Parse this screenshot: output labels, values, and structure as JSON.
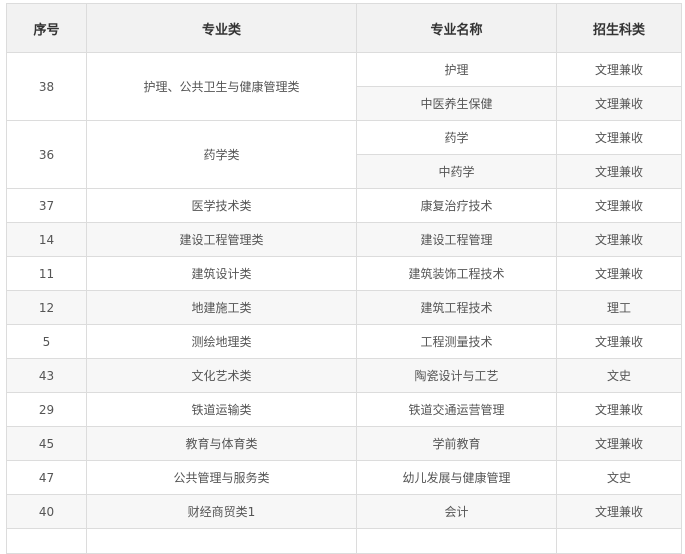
{
  "table": {
    "headers": [
      "序号",
      "专业类",
      "专业名称",
      "招生科类"
    ],
    "rows": [
      {
        "num": "38",
        "category": "护理、公共卫生与健康管理类",
        "majors": [
          {
            "name": "护理",
            "subject": "文理兼收"
          },
          {
            "name": "中医养生保健",
            "subject": "文理兼收"
          }
        ]
      },
      {
        "num": "36",
        "category": "药学类",
        "majors": [
          {
            "name": "药学",
            "subject": "文理兼收"
          },
          {
            "name": "中药学",
            "subject": "文理兼收"
          }
        ]
      },
      {
        "num": "37",
        "category": "医学技术类",
        "majors": [
          {
            "name": "康复治疗技术",
            "subject": "文理兼收"
          }
        ]
      },
      {
        "num": "14",
        "category": "建设工程管理类",
        "majors": [
          {
            "name": "建设工程管理",
            "subject": "文理兼收"
          }
        ]
      },
      {
        "num": "11",
        "category": "建筑设计类",
        "majors": [
          {
            "name": "建筑装饰工程技术",
            "subject": "文理兼收"
          }
        ]
      },
      {
        "num": "12",
        "category": "地建施工类",
        "majors": [
          {
            "name": "建筑工程技术",
            "subject": "理工"
          }
        ]
      },
      {
        "num": "5",
        "category": "测绘地理类",
        "majors": [
          {
            "name": "工程测量技术",
            "subject": "文理兼收"
          }
        ]
      },
      {
        "num": "43",
        "category": "文化艺术类",
        "majors": [
          {
            "name": "陶瓷设计与工艺",
            "subject": "文史"
          }
        ]
      },
      {
        "num": "29",
        "category": "铁道运输类",
        "majors": [
          {
            "name": "铁道交通运营管理",
            "subject": "文理兼收"
          }
        ]
      },
      {
        "num": "45",
        "category": "教育与体育类",
        "majors": [
          {
            "name": "学前教育",
            "subject": "文理兼收"
          }
        ]
      },
      {
        "num": "47",
        "category": "公共管理与服务类",
        "majors": [
          {
            "name": "幼儿发展与健康管理",
            "subject": "文史"
          }
        ]
      },
      {
        "num": "40",
        "category": "财经商贸类1",
        "majors": [
          {
            "name": "会计",
            "subject": "文理兼收"
          }
        ]
      }
    ]
  }
}
